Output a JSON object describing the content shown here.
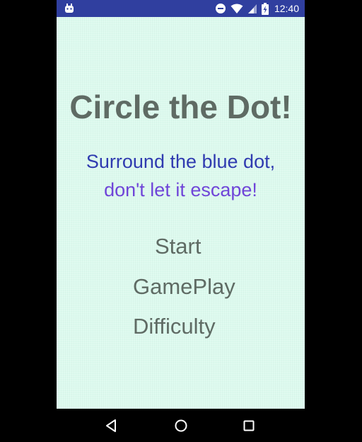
{
  "status_bar": {
    "time": "12:40",
    "icons": [
      "android-debug-icon",
      "do-not-disturb-icon",
      "wifi-icon",
      "cell-signal-icon",
      "battery-charging-icon"
    ],
    "color": "#303f9f"
  },
  "screen": {
    "background_color": "#dcfaee",
    "title": "Circle the Dot!",
    "subtitle_line1": "Surround the blue dot,",
    "subtitle_line2": "don't let it escape!",
    "title_color": "#5f6b64",
    "subtitle_line1_color": "#2f3bb0",
    "subtitle_line2_color": "#6f45d8"
  },
  "menu": {
    "items": [
      {
        "label": "Start"
      },
      {
        "label": "GamePlay"
      },
      {
        "label": "Difficulty"
      }
    ]
  },
  "nav_bar": {
    "buttons": [
      "back-icon",
      "home-icon",
      "recents-icon"
    ]
  }
}
